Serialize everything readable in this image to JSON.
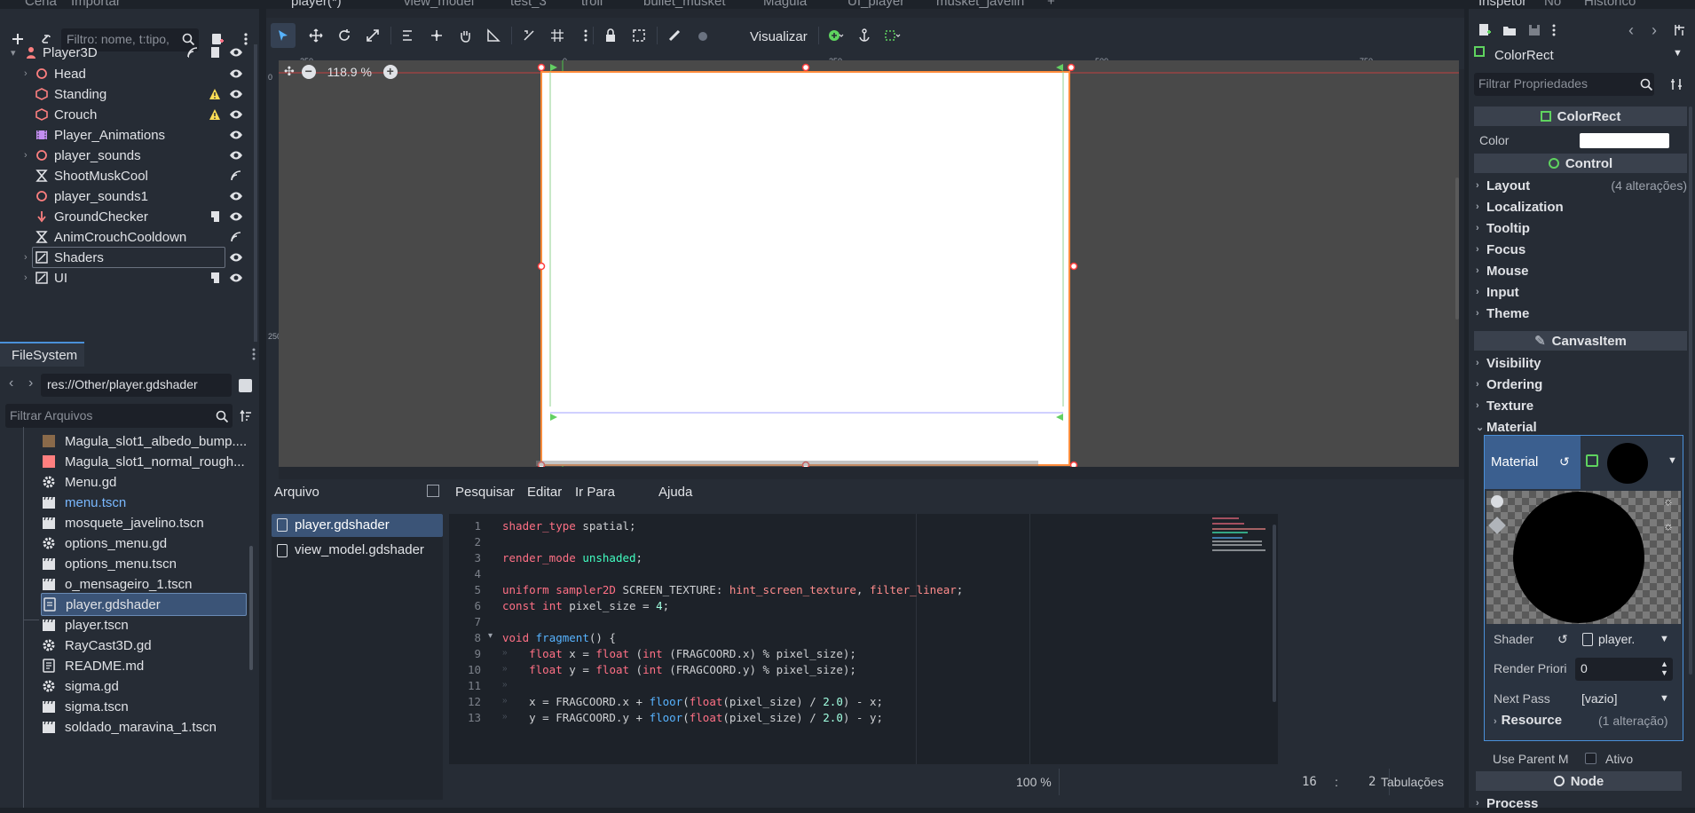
{
  "top_tabs": [
    "Cena",
    "Importar",
    "player(*)",
    "view_model",
    "test_3",
    "troll",
    "bullet_musket",
    "Magula",
    "UI_player",
    "musket_javelin",
    "Inspetor",
    "Nó",
    "Histórico"
  ],
  "scene": {
    "filter_placeholder": "Filtro: nome, t:tipo,",
    "root": "Player3D",
    "nodes": [
      {
        "label": "Head",
        "icon": "node3d-icon"
      },
      {
        "label": "Standing",
        "icon": "collision-icon",
        "warn": true
      },
      {
        "label": "Crouch",
        "icon": "collision-icon",
        "warn": true
      },
      {
        "label": "Player_Animations",
        "icon": "animation-player-icon"
      },
      {
        "label": "player_sounds",
        "icon": "node3d-icon"
      },
      {
        "label": "ShootMuskCool",
        "icon": "timer-icon"
      },
      {
        "label": "player_sounds1",
        "icon": "node3d-icon"
      },
      {
        "label": "GroundChecker",
        "icon": "raycast-icon"
      },
      {
        "label": "AnimCrouchCooldown",
        "icon": "timer-icon"
      },
      {
        "label": "Shaders",
        "icon": "canvaslayer-icon"
      },
      {
        "label": "UI",
        "icon": "canvaslayer-icon"
      }
    ]
  },
  "filesystem": {
    "tab": "FileSystem",
    "path": "res://Other/player.gdshader",
    "filter_placeholder": "Filtrar Arquivos",
    "files": [
      {
        "label": "Magula_slot1_albedo_bump....",
        "icon": "texture-icon"
      },
      {
        "label": "Magula_slot1_normal_rough...",
        "icon": "texture-icon"
      },
      {
        "label": "Menu.gd",
        "icon": "gear-icon"
      },
      {
        "label": "menu.tscn",
        "icon": "scene-icon",
        "blue": true
      },
      {
        "label": "mosquete_javelino.tscn",
        "icon": "scene-icon"
      },
      {
        "label": "options_menu.gd",
        "icon": "gear-icon"
      },
      {
        "label": "options_menu.tscn",
        "icon": "scene-icon"
      },
      {
        "label": "o_mensageiro_1.tscn",
        "icon": "scene-icon"
      },
      {
        "label": "player.gdshader",
        "icon": "shader-file-icon",
        "selected": true
      },
      {
        "label": "player.tscn",
        "icon": "scene-icon"
      },
      {
        "label": "RayCast3D.gd",
        "icon": "gear-icon"
      },
      {
        "label": "README.md",
        "icon": "text-file-icon"
      },
      {
        "label": "sigma.gd",
        "icon": "gear-icon"
      },
      {
        "label": "sigma.tscn",
        "icon": "scene-icon"
      },
      {
        "label": "soldado_maravina_1.tscn",
        "icon": "scene-icon"
      }
    ]
  },
  "viewport": {
    "toolbar_visualizar": "Visualizar",
    "zoom": "118.9 %",
    "ruler_labels": [
      "-250",
      "0",
      "250",
      "500",
      "750"
    ],
    "vruler_labels": [
      "0",
      "250"
    ]
  },
  "editor": {
    "menus": [
      "Arquivo",
      "Pesquisar",
      "Editar",
      "Ir Para",
      "Ajuda"
    ],
    "files": [
      "player.gdshader",
      "view_model.gdshader"
    ],
    "line_numbers": [
      "1",
      "2",
      "3",
      "4",
      "5",
      "6",
      "7",
      "8",
      "9",
      "10",
      "11",
      "12",
      "13"
    ],
    "status_zoom": "100 %",
    "status_line": "16",
    "status_col": "2",
    "status_indent": "Tabulações"
  },
  "inspector": {
    "node_type": "ColorRect",
    "filter_placeholder": "Filtrar Propriedades",
    "header": "ColorRect",
    "color_label": "Color",
    "control": "Control",
    "categories": [
      {
        "label": "Layout",
        "note": "(4 alterações)"
      },
      {
        "label": "Localization",
        "note": ""
      },
      {
        "label": "Tooltip",
        "note": ""
      },
      {
        "label": "Focus",
        "note": ""
      },
      {
        "label": "Mouse",
        "note": ""
      },
      {
        "label": "Input",
        "note": ""
      },
      {
        "label": "Theme",
        "note": ""
      }
    ],
    "canvas_item": "CanvasItem",
    "categories2": [
      "Visibility",
      "Ordering",
      "Texture",
      "Material"
    ],
    "material_label": "Material",
    "shader_label": "Shader",
    "shader_value": "player.",
    "render_priority_label": "Render Priori",
    "render_priority_value": "0",
    "next_pass_label": "Next Pass",
    "next_pass_value": "[vazio]",
    "resource_label": "Resource",
    "resource_note": "(1 alteração)",
    "use_parent_label": "Use Parent M",
    "use_parent_value": "Ativo",
    "node_section": "Node",
    "process_label": "Process"
  },
  "colors": {
    "accent": "#4a90d9",
    "selection": "#3b5477",
    "warning": "#ffdd55"
  }
}
